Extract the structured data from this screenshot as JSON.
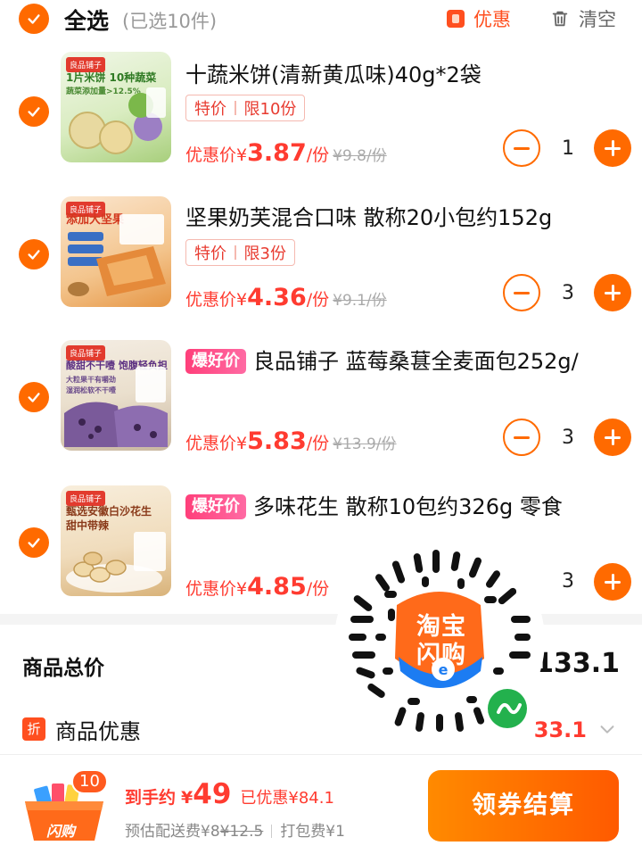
{
  "header": {
    "title": "全选",
    "count": "(已选10件)",
    "discount_label": "优惠",
    "clear_label": "清空"
  },
  "items": [
    {
      "title": "十蔬米饼(清新黄瓜味)40g*2袋",
      "tag1": "特价",
      "tag2": "限10份",
      "price_label": "优惠价",
      "currency": "¥",
      "price": "3.87",
      "unit": "/份",
      "orig_price": "¥9.8/份",
      "qty": "1",
      "thumb_lines": [
        "1片米饼 10种蔬菜",
        "蔬菜添加量>12.5%"
      ],
      "thumb_brand": "良品铺子",
      "thumb_colors": [
        "#a8cf7c",
        "#f1f7e8"
      ]
    },
    {
      "title": "坚果奶芙混合口味 散称20小包约152g",
      "tag1": "特价",
      "tag2": "限3份",
      "price_label": "优惠价",
      "currency": "¥",
      "price": "4.36",
      "unit": "/份",
      "orig_price": "¥9.1/份",
      "qty": "3",
      "thumb_lines": [
        "添加大坚果"
      ],
      "thumb_brand": "良品铺子",
      "thumb_colors": [
        "#e69645",
        "#fbe6cf"
      ]
    },
    {
      "hot": "爆好价",
      "title": "良品铺子 蓝莓桑葚全麦面包252g/",
      "price_label": "优惠价",
      "currency": "¥",
      "price": "5.83",
      "unit": "/份",
      "orig_price": "¥13.9/份",
      "qty": "3",
      "thumb_lines": [
        "酸甜不干噎 饱腹轻负担",
        "大粒果干有嚼劲",
        "湿润松软不干噎"
      ],
      "thumb_brand": "良品铺子",
      "thumb_colors": [
        "#8a6aa8",
        "#f4ede3"
      ]
    },
    {
      "hot": "爆好价",
      "title": "多味花生 散称10包约326g 零食",
      "price_label": "优惠价",
      "currency": "¥",
      "price": "4.85",
      "unit": "/份",
      "qty": "3",
      "thumb_lines": [
        "甄选安徽白沙花生",
        "甜中带辣"
      ],
      "thumb_brand": "良品铺子",
      "thumb_colors": [
        "#e8b86a",
        "#f8eedc"
      ]
    }
  ],
  "summary": {
    "total_label": "商品总价",
    "total_value": "133.1",
    "discount_icon": "折",
    "discount_label": "商品优惠",
    "discount_value": "33.1"
  },
  "bottom": {
    "cart_badge": "10",
    "cart_icon_text": "闪购",
    "pay_label": "到手约",
    "pay_currency": "¥",
    "pay_value": "49",
    "saved": "已优惠¥84.1",
    "ship_label": "预估配送费¥8",
    "ship_orig": "¥12.5",
    "pack_fee": "打包费¥1",
    "checkout_label": "领券结算"
  },
  "qr": {
    "line1": "淘宝",
    "line2": "闪购"
  },
  "colors": {
    "accent": "#ff6a00",
    "price": "#ff3b30",
    "tag_border": "#f5b9b0"
  }
}
